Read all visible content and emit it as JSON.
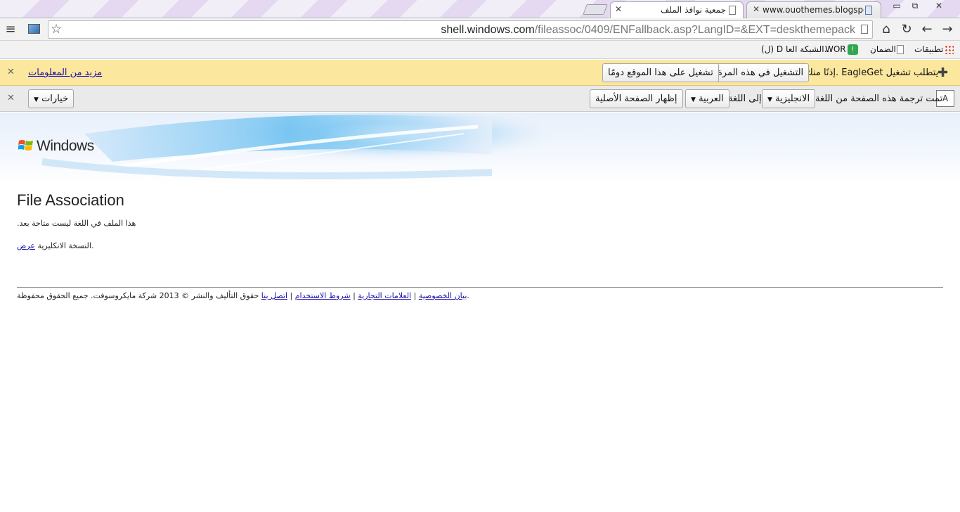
{
  "tabs": [
    {
      "title": "www.ouothemes.blogspo",
      "active": false
    },
    {
      "title": "جمعية نوافذ الملف",
      "active": true
    }
  ],
  "window_controls": {
    "minimize": "▭",
    "restore": "⧉",
    "close": "✕"
  },
  "address": {
    "host": "shell.windows.com",
    "path": "/fileassoc/0409/ENFallback.asp?LangID=&EXT=deskthemepack"
  },
  "bookmarks": {
    "apps": "تطبيقات",
    "item1": "الضمان",
    "item2": "WOR",
    "item3": "(ل) D الشبكة العا..."
  },
  "eagle_bar": {
    "message_prefix": "يتطلب تشغيل",
    "plugin_name": "EagleGet",
    "message_suffix": "إذنًا منك.",
    "run_once": "التشغيل في هذه المرة",
    "always_run": "تشغيل على هذا الموقع دومًا",
    "learn_more": "مزيد من المعلومات"
  },
  "translate_bar": {
    "translated_from": "تمت ترجمة هذه الصفحة من اللغة",
    "source_lang": "الانجليزية",
    "to_label": "إلى اللغة",
    "target_lang": "العربية",
    "show_original": "إظهار الصفحة الأصلية",
    "options": "خيارات"
  },
  "page": {
    "logo_text": "Windows",
    "heading": "File Association",
    "line1": ".هذا الملف في اللغة ليست متاحة بعد",
    "line2_link": "عرض",
    "line2_rest": " النسخة الانكليزية",
    "line2_end": ".",
    "footer_copyright": "حقوق التأليف والنشر © 2013 شركة مايكروسوفت. جميع الحقوق محفوظة.",
    "footer_links": [
      "اتصل بنا",
      "شروط الاستخدام",
      "العلامات التجارية",
      "بيان الخصوصية"
    ],
    "footer_sep": " | "
  },
  "colors": {
    "infobar_yellow": "#fbe79d",
    "translate_gray": "#eaeaea",
    "link": "#1a0dab"
  }
}
